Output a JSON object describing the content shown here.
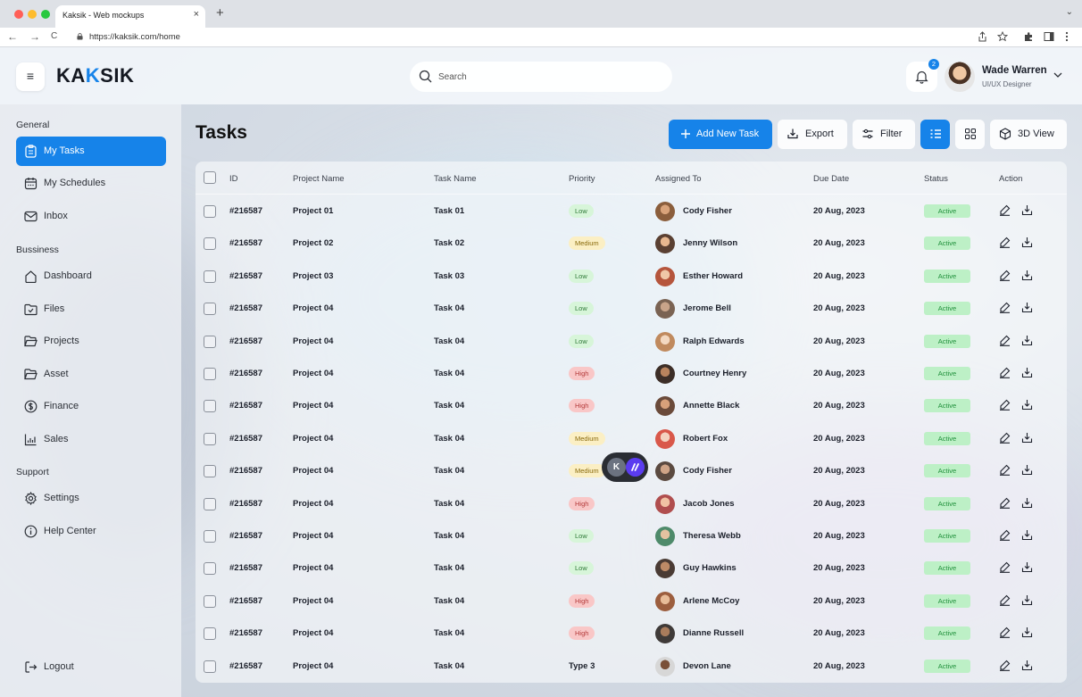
{
  "browser": {
    "tab_title": "Kaksik - Web mockups",
    "tab_close": "×",
    "new_tab": "+",
    "tab_menu": "⌄",
    "url": "https://kaksik.com/home",
    "back": "←",
    "forward": "→",
    "reload": "C",
    "icons": [
      "share-icon",
      "star-icon",
      "extensions-icon",
      "sidepanel-icon",
      "more-icon"
    ]
  },
  "header": {
    "menu_icon": "≡",
    "logo_pre": "KA",
    "logo_accent": "K",
    "logo_post": "SIK",
    "search_placeholder": "Search",
    "notification_count": "2",
    "user_name": "Wade Warren",
    "user_role": "UI/UX Designer"
  },
  "sidebar": {
    "general_title": "General",
    "general_items": [
      {
        "label": "My Tasks",
        "icon": "clipboard-icon",
        "active": true
      },
      {
        "label": "My Schedules",
        "icon": "calendar-icon",
        "active": false
      },
      {
        "label": "Inbox",
        "icon": "mail-icon",
        "active": false
      }
    ],
    "business_title": "Bussiness",
    "business_items": [
      {
        "label": "Dashboard",
        "icon": "home-icon"
      },
      {
        "label": "Files",
        "icon": "folder-check-icon"
      },
      {
        "label": "Projects",
        "icon": "folder-open-icon"
      },
      {
        "label": "Asset",
        "icon": "folder-open-icon"
      },
      {
        "label": "Finance",
        "icon": "dollar-icon"
      },
      {
        "label": "Sales",
        "icon": "chart-icon"
      }
    ],
    "support_title": "Support",
    "support_items": [
      {
        "label": "Settings",
        "icon": "gear-icon"
      },
      {
        "label": "Help Center",
        "icon": "info-icon"
      }
    ],
    "logout_label": "Logout"
  },
  "main": {
    "title": "Tasks",
    "toolbar": {
      "add_label": "Add New Task",
      "export_label": "Export",
      "filter_label": "Filter",
      "view3d_label": "3D View"
    }
  },
  "table": {
    "columns": [
      "ID",
      "Project Name",
      "Task Name",
      "Priority",
      "Assigned To",
      "Due Date",
      "Status",
      "Action"
    ],
    "rows": [
      {
        "id": "#216587",
        "project": "Project 01",
        "task": "Task 01",
        "priority": "Low",
        "assignee": "Cody Fisher",
        "due": "20 Aug, 2023",
        "status": "Active"
      },
      {
        "id": "#216587",
        "project": "Project 02",
        "task": "Task 02",
        "priority": "Medium",
        "assignee": "Jenny Wilson",
        "due": "20 Aug, 2023",
        "status": "Active"
      },
      {
        "id": "#216587",
        "project": "Project 03",
        "task": "Task 03",
        "priority": "Low",
        "assignee": "Esther Howard",
        "due": "20 Aug, 2023",
        "status": "Active"
      },
      {
        "id": "#216587",
        "project": "Project 04",
        "task": "Task 04",
        "priority": "Low",
        "assignee": "Jerome Bell",
        "due": "20 Aug, 2023",
        "status": "Active"
      },
      {
        "id": "#216587",
        "project": "Project 04",
        "task": "Task 04",
        "priority": "Low",
        "assignee": "Ralph Edwards",
        "due": "20 Aug, 2023",
        "status": "Active"
      },
      {
        "id": "#216587",
        "project": "Project 04",
        "task": "Task 04",
        "priority": "High",
        "assignee": "Courtney Henry",
        "due": "20 Aug, 2023",
        "status": "Active"
      },
      {
        "id": "#216587",
        "project": "Project 04",
        "task": "Task 04",
        "priority": "High",
        "assignee": "Annette Black",
        "due": "20 Aug, 2023",
        "status": "Active"
      },
      {
        "id": "#216587",
        "project": "Project 04",
        "task": "Task 04",
        "priority": "Medium",
        "assignee": "Robert Fox",
        "due": "20 Aug, 2023",
        "status": "Active"
      },
      {
        "id": "#216587",
        "project": "Project 04",
        "task": "Task 04",
        "priority": "Medium",
        "assignee": "Cody Fisher",
        "due": "20 Aug, 2023",
        "status": "Active"
      },
      {
        "id": "#216587",
        "project": "Project 04",
        "task": "Task 04",
        "priority": "High",
        "assignee": "Jacob Jones",
        "due": "20 Aug, 2023",
        "status": "Active"
      },
      {
        "id": "#216587",
        "project": "Project 04",
        "task": "Task 04",
        "priority": "Low",
        "assignee": "Theresa Webb",
        "due": "20 Aug, 2023",
        "status": "Active"
      },
      {
        "id": "#216587",
        "project": "Project 04",
        "task": "Task 04",
        "priority": "Low",
        "assignee": "Guy Hawkins",
        "due": "20 Aug, 2023",
        "status": "Active"
      },
      {
        "id": "#216587",
        "project": "Project 04",
        "task": "Task 04",
        "priority": "High",
        "assignee": "Arlene McCoy",
        "due": "20 Aug, 2023",
        "status": "Active"
      },
      {
        "id": "#216587",
        "project": "Project 04",
        "task": "Task 04",
        "priority": "High",
        "assignee": "Dianne Russell",
        "due": "20 Aug, 2023",
        "status": "Active"
      },
      {
        "id": "#216587",
        "project": "Project 04",
        "task": "Task 04",
        "priority": "Type 3",
        "assignee": "Devon Lane",
        "due": "20 Aug, 2023",
        "status": "Active"
      }
    ]
  },
  "floating_widget": {
    "badge_letter": "K"
  },
  "colors": {
    "accent": "#1683e9",
    "priority_low": "#d7f5d9",
    "priority_medium": "#fbefc4",
    "priority_high": "#f9c7c7",
    "status_active": "#bdf0c6"
  }
}
